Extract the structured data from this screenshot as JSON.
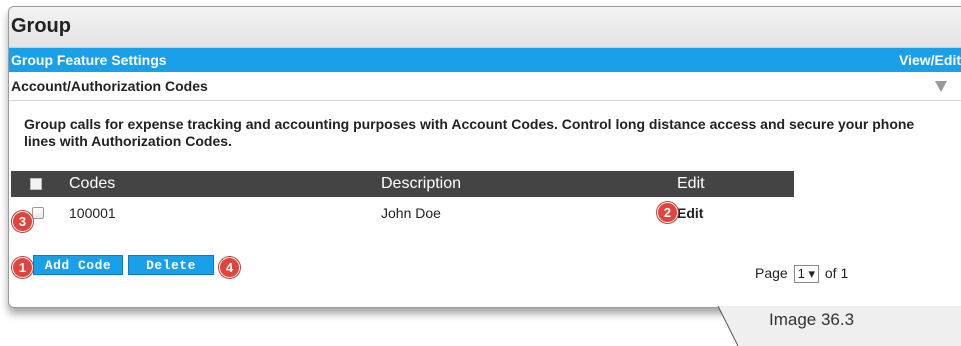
{
  "header": {
    "title": "Group"
  },
  "feature_bar": {
    "title": "Group Feature Settings",
    "view_edit": "View/Edit"
  },
  "section": {
    "title": "Account/Authorization Codes"
  },
  "description": "Group calls for expense tracking and accounting purposes with Account Codes. Control long distance access and secure your phone lines with Authorization Codes.",
  "table": {
    "columns": [
      "Codes",
      "Description",
      "Edit"
    ],
    "rows": [
      {
        "code": "100001",
        "description": "John Doe",
        "edit": "Edit"
      }
    ]
  },
  "buttons": {
    "add_code": "Add Code",
    "delete": "Delete"
  },
  "pager": {
    "prefix": "Page",
    "current": "1",
    "suffix": "of 1"
  },
  "callouts": [
    "1",
    "2",
    "3",
    "4"
  ],
  "caption": "Image 36.3",
  "colors": {
    "accent": "#1aa0e8",
    "callout": "#e0443c",
    "table_header": "#444444"
  }
}
